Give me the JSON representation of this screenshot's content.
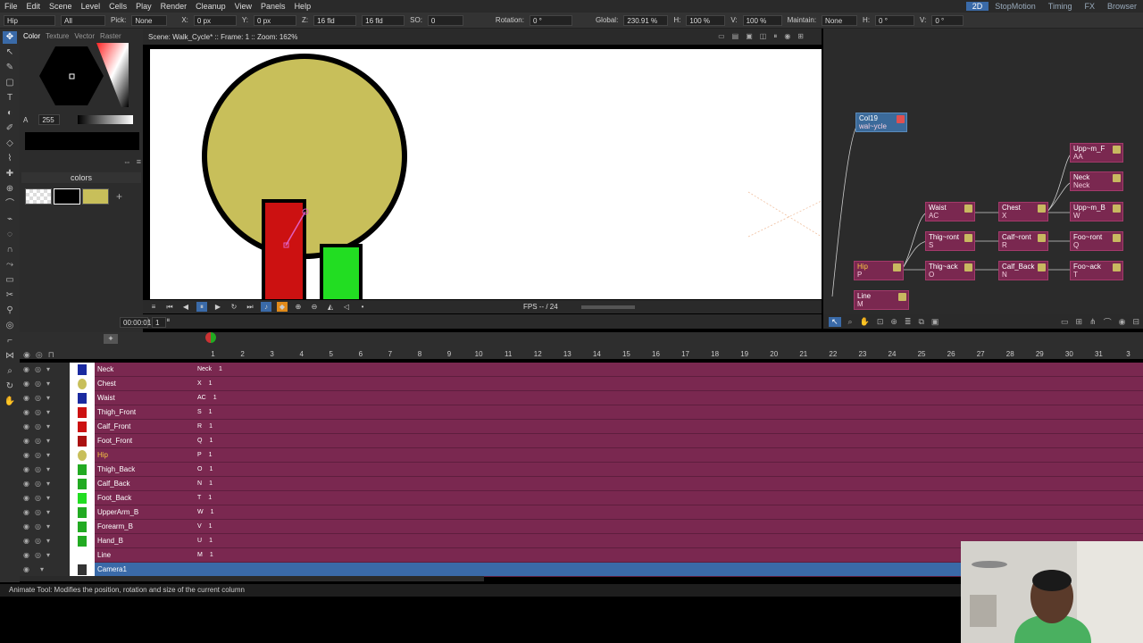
{
  "menu": [
    "File",
    "Edit",
    "Scene",
    "Level",
    "Cells",
    "Play",
    "Render",
    "Cleanup",
    "View",
    "Panels",
    "Help"
  ],
  "rooms": [
    {
      "label": "2D",
      "active": true
    },
    {
      "label": "StopMotion",
      "active": false
    },
    {
      "label": "Timing",
      "active": false
    },
    {
      "label": "FX",
      "active": false
    },
    {
      "label": "Browser",
      "active": false
    }
  ],
  "toolopts": {
    "object": "Hip",
    "mode": "All",
    "pick_label": "Pick:",
    "pick_value": "None",
    "x_label": "X:",
    "x_value": "0 px",
    "y_label": "Y:",
    "y_value": "0 px",
    "z_label": "Z:",
    "z_value": "16 fld",
    "z2_value": "16 fld",
    "so_label": "SO:",
    "so_value": "0",
    "rotation_label": "Rotation:",
    "rotation_value": "0 °",
    "global_label": "Global:",
    "global_value": "230.91 %",
    "h_label": "H:",
    "h_value": "100 %",
    "v_label": "V:",
    "v_value": "100 %",
    "maintain_label": "Maintain:",
    "maintain_value": "None",
    "h2_label": "H:",
    "h2_value": "0 °",
    "v2_label": "V:",
    "v2_value": "0 °"
  },
  "style": {
    "tabs": [
      "Color",
      "Texture",
      "Vector",
      "Raster"
    ],
    "alpha_label": "A",
    "alpha_value": "255",
    "palette_name": "colors",
    "swatches": [
      "#ffffff",
      "#000000",
      "#c8bf5a"
    ]
  },
  "viewer": {
    "title": "Scene: Walk_Cycle*  ::  Frame: 1  ::  Zoom: 162%",
    "fps": "FPS -- / 24",
    "frame_field": "00:00:01",
    "frame_value": "1"
  },
  "colors": {
    "head": "#c8bf5a",
    "red": "#cc1111",
    "green": "#22dd22",
    "accent": "#3a6aa8",
    "row": "#7a2850"
  },
  "schematic": {
    "nodes": [
      {
        "label": "Col19",
        "sub": "wal~ycle"
      },
      {
        "label": "Waist",
        "sub": "AC"
      },
      {
        "label": "Chest",
        "sub": "X"
      },
      {
        "label": "Upp~m_F",
        "sub": "AA"
      },
      {
        "label": "Neck",
        "sub": "Neck"
      },
      {
        "label": "Upp~m_B",
        "sub": "W"
      },
      {
        "label": "Thig~ront",
        "sub": "S"
      },
      {
        "label": "Calf~ront",
        "sub": "R"
      },
      {
        "label": "Foo~ront",
        "sub": "Q"
      },
      {
        "label": "Hip",
        "sub": "P"
      },
      {
        "label": "Thig~ack",
        "sub": "O"
      },
      {
        "label": "Calf_Back",
        "sub": "N"
      },
      {
        "label": "Foo~ack",
        "sub": "T"
      },
      {
        "label": "Line",
        "sub": "M"
      }
    ]
  },
  "xsheet": {
    "columns": [
      "1",
      "2",
      "3",
      "4",
      "5",
      "6",
      "7",
      "8",
      "9",
      "10",
      "11",
      "12",
      "13",
      "14",
      "15",
      "16",
      "17",
      "18",
      "19",
      "20",
      "21",
      "22",
      "23",
      "24",
      "25",
      "26",
      "27",
      "28",
      "29",
      "30",
      "31",
      "3"
    ],
    "rows": [
      {
        "name": "Neck",
        "level": "Neck",
        "frame": "1"
      },
      {
        "name": "Chest",
        "level": "X",
        "frame": "1"
      },
      {
        "name": "Waist",
        "level": "AC",
        "frame": "1"
      },
      {
        "name": "Thigh_Front",
        "level": "S",
        "frame": "1"
      },
      {
        "name": "Calf_Front",
        "level": "R",
        "frame": "1"
      },
      {
        "name": "Foot_Front",
        "level": "Q",
        "frame": "1"
      },
      {
        "name": "Hip",
        "level": "P",
        "frame": "1",
        "selected": true
      },
      {
        "name": "Thigh_Back",
        "level": "O",
        "frame": "1"
      },
      {
        "name": "Calf_Back",
        "level": "N",
        "frame": "1"
      },
      {
        "name": "Foot_Back",
        "level": "T",
        "frame": "1"
      },
      {
        "name": "UpperArm_B",
        "level": "W",
        "frame": "1"
      },
      {
        "name": "Forearm_B",
        "level": "V",
        "frame": "1"
      },
      {
        "name": "Hand_B",
        "level": "U",
        "frame": "1"
      },
      {
        "name": "Line",
        "level": "M",
        "frame": "1"
      },
      {
        "name": "Camera1",
        "level": "",
        "frame": "",
        "camera": true
      }
    ]
  },
  "status": "Animate Tool: Modifies the position, rotation and size of the current column"
}
